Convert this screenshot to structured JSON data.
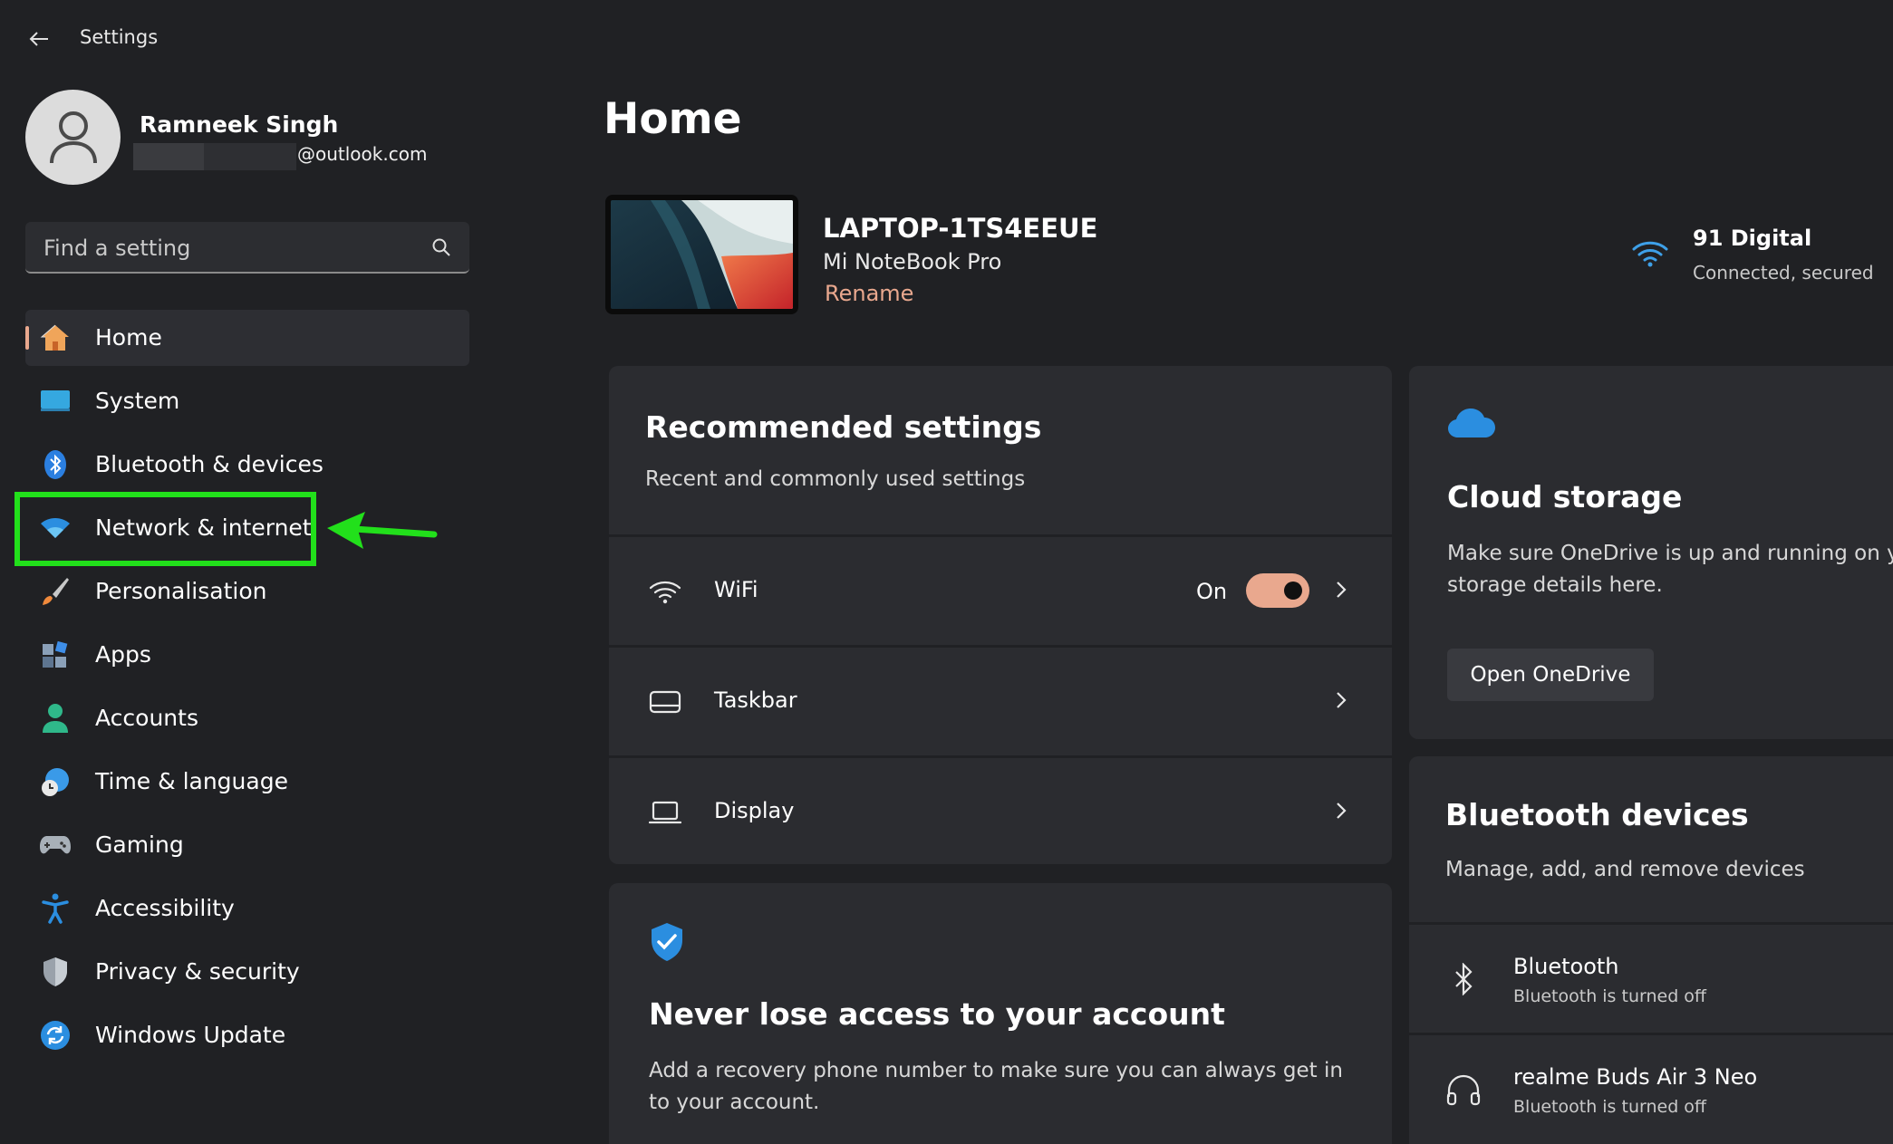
{
  "window": {
    "title": "Settings"
  },
  "profile": {
    "name": "Ramneek Singh",
    "email_suffix": "@outlook.com"
  },
  "search": {
    "placeholder": "Find a setting"
  },
  "nav": {
    "items": [
      {
        "label": "Home",
        "icon": "home-icon",
        "active": true
      },
      {
        "label": "System",
        "icon": "system-icon"
      },
      {
        "label": "Bluetooth & devices",
        "icon": "bluetooth-icon"
      },
      {
        "label": "Network & internet",
        "icon": "wifi-icon",
        "highlighted": true
      },
      {
        "label": "Personalisation",
        "icon": "brush-icon"
      },
      {
        "label": "Apps",
        "icon": "apps-icon"
      },
      {
        "label": "Accounts",
        "icon": "accounts-icon"
      },
      {
        "label": "Time & language",
        "icon": "globe-clock-icon"
      },
      {
        "label": "Gaming",
        "icon": "gamepad-icon"
      },
      {
        "label": "Accessibility",
        "icon": "accessibility-icon"
      },
      {
        "label": "Privacy & security",
        "icon": "shield-icon"
      },
      {
        "label": "Windows Update",
        "icon": "update-icon"
      }
    ]
  },
  "main": {
    "title": "Home",
    "device": {
      "name": "LAPTOP-1TS4EEUE",
      "model": "Mi NoteBook Pro",
      "rename_label": "Rename"
    },
    "network": {
      "name": "91 Digital",
      "status": "Connected, secured"
    },
    "recommended": {
      "title": "Recommended settings",
      "subtitle": "Recent and commonly used settings",
      "rows": [
        {
          "label": "WiFi",
          "state": "On",
          "icon": "wifi-icon",
          "toggle_on": true
        },
        {
          "label": "Taskbar",
          "icon": "taskbar-icon"
        },
        {
          "label": "Display",
          "icon": "laptop-icon"
        }
      ]
    },
    "account": {
      "title": "Never lose access to your account",
      "text": "Add a recovery phone number to make sure you can always get in to your account."
    },
    "cloud": {
      "title": "Cloud storage",
      "text_line1": "Make sure OneDrive is up and running on you",
      "text_line2": "storage details here.",
      "button": "Open OneDrive"
    },
    "bluetooth": {
      "title": "Bluetooth devices",
      "subtitle": "Manage, add, and remove devices",
      "devices": [
        {
          "name": "Bluetooth",
          "status": "Bluetooth is turned off",
          "icon": "bluetooth-icon"
        },
        {
          "name": "realme Buds Air 3 Neo",
          "status": "Bluetooth is turned off",
          "icon": "headphones-icon"
        }
      ]
    }
  },
  "colors": {
    "accent": "#e9a88e",
    "highlight": "#22e01b",
    "background": "#202124",
    "card": "#2b2c30"
  }
}
